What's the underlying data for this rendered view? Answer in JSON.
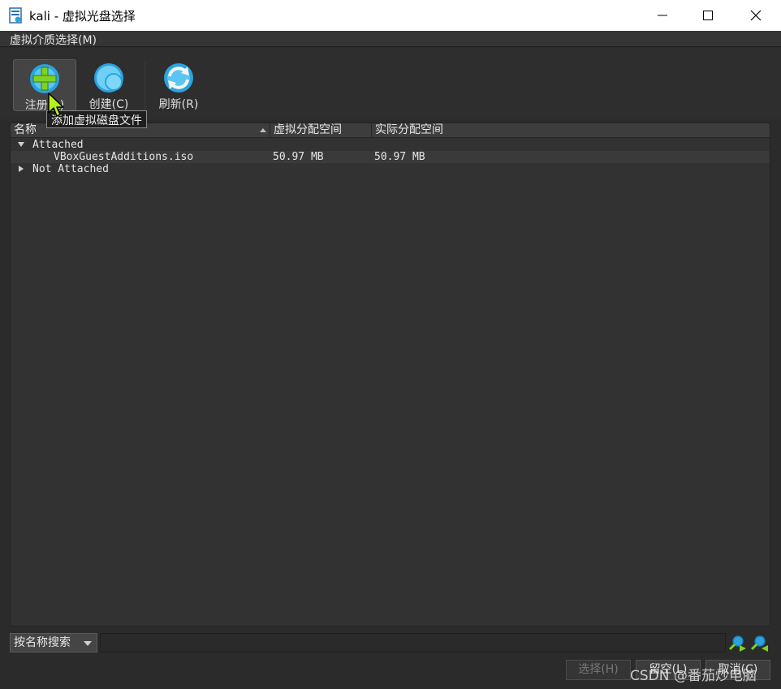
{
  "window": {
    "title": "kali - 虚拟光盘选择",
    "controls": [
      "minimize",
      "maximize",
      "close"
    ]
  },
  "menu": {
    "items": [
      {
        "label": "虚拟介质选择(M)"
      }
    ]
  },
  "toolbar": {
    "register_label": "注册(A)",
    "create_label": "创建(C)",
    "refresh_label": "刷新(R)",
    "tooltip": "添加虚拟磁盘文件"
  },
  "tree": {
    "columns": [
      "名称",
      "虚拟分配空间",
      "实际分配空间"
    ],
    "groups": [
      {
        "label": "Attached",
        "expanded": true,
        "items": [
          {
            "name": "VBoxGuestAdditions.iso",
            "virtual_size": "50.97 MB",
            "actual_size": "50.97 MB"
          }
        ]
      },
      {
        "label": "Not Attached",
        "expanded": false,
        "items": []
      }
    ]
  },
  "search": {
    "mode_label": "按名称搜索",
    "value": ""
  },
  "buttons": {
    "choose_label": "选择(H)",
    "leave_label": "留空(L)",
    "cancel_label": "取消(C)"
  },
  "watermark": "CSDN @番茄炒电脑",
  "colors": {
    "background": "#2b2b2b",
    "panel": "#323232",
    "accent_blue": "#2aa3e0",
    "accent_green": "#7ed321"
  },
  "icons": [
    "disk-add-icon",
    "disk-create-icon",
    "refresh-icon",
    "search-forward-icon",
    "search-backward-icon"
  ]
}
